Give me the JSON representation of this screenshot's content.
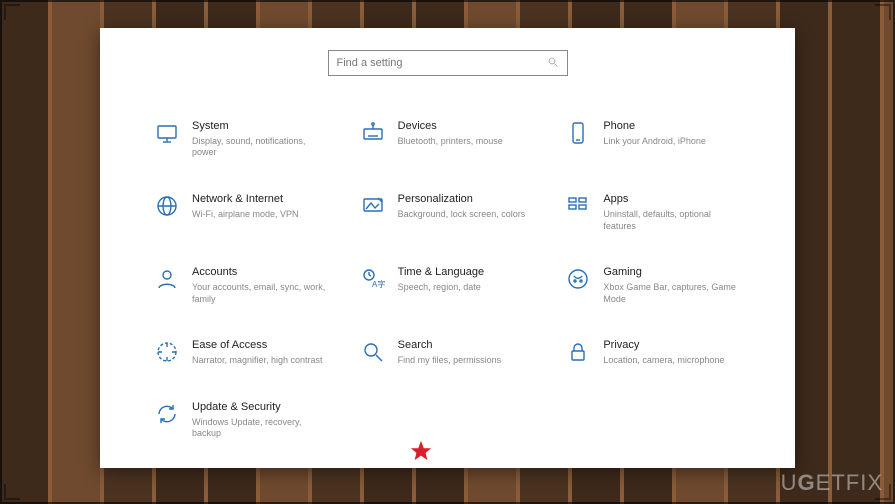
{
  "watermark": "UGETFIX",
  "search": {
    "placeholder": "Find a setting"
  },
  "categories": [
    {
      "id": "system",
      "icon": "monitor-icon",
      "title": "System",
      "desc": "Display, sound, notifications, power"
    },
    {
      "id": "devices",
      "icon": "keyboard-icon",
      "title": "Devices",
      "desc": "Bluetooth, printers, mouse"
    },
    {
      "id": "phone",
      "icon": "phone-icon",
      "title": "Phone",
      "desc": "Link your Android, iPhone"
    },
    {
      "id": "network",
      "icon": "globe-icon",
      "title": "Network & Internet",
      "desc": "Wi-Fi, airplane mode, VPN"
    },
    {
      "id": "personalization",
      "icon": "paint-icon",
      "title": "Personalization",
      "desc": "Background, lock screen, colors"
    },
    {
      "id": "apps",
      "icon": "apps-icon",
      "title": "Apps",
      "desc": "Uninstall, defaults, optional features"
    },
    {
      "id": "accounts",
      "icon": "person-icon",
      "title": "Accounts",
      "desc": "Your accounts, email, sync, work, family"
    },
    {
      "id": "time",
      "icon": "time-lang-icon",
      "title": "Time & Language",
      "desc": "Speech, region, date"
    },
    {
      "id": "gaming",
      "icon": "gamepad-icon",
      "title": "Gaming",
      "desc": "Xbox Game Bar, captures, Game Mode"
    },
    {
      "id": "ease",
      "icon": "ease-icon",
      "title": "Ease of Access",
      "desc": "Narrator, magnifier, high contrast"
    },
    {
      "id": "search",
      "icon": "search-cat-icon",
      "title": "Search",
      "desc": "Find my files, permissions"
    },
    {
      "id": "privacy",
      "icon": "lock-icon",
      "title": "Privacy",
      "desc": "Location, camera, microphone"
    },
    {
      "id": "update",
      "icon": "sync-icon",
      "title": "Update & Security",
      "desc": "Windows Update, recovery, backup"
    }
  ],
  "annotation": {
    "star_target": "update"
  }
}
